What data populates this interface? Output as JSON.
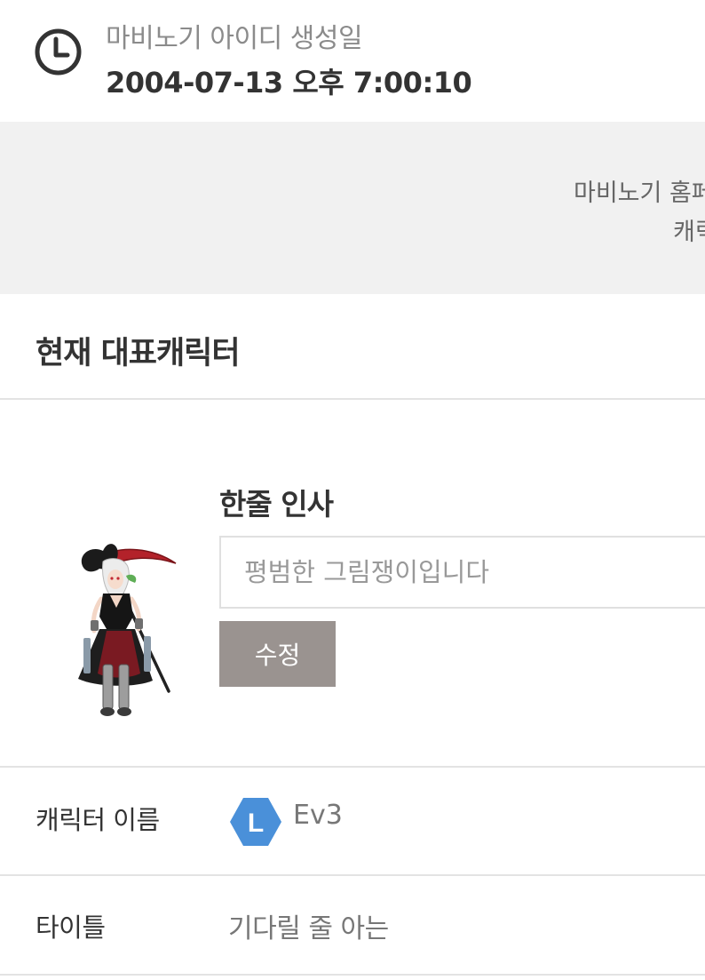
{
  "created": {
    "icon": "clock-icon",
    "label": "마비노기 아이디 생성일",
    "value": "2004-07-13 오후 7:00:10"
  },
  "notice": {
    "line1": "마비노기 홈페",
    "line2": "캐릭"
  },
  "section": {
    "title": "현재 대표캐릭터"
  },
  "profile": {
    "greeting_label": "한줄 인사",
    "greeting_value": "평범한 그림쟁이입니다",
    "edit_button": "수정"
  },
  "character": {
    "name_label": "캐릭터 이름",
    "server_badge_letter": "L",
    "server_badge_color": "#4a90d9",
    "name": "Ev3",
    "title_label": "타이틀",
    "title": "기다릴 줄 아는"
  },
  "colors": {
    "notice_background": "#f1f1f1",
    "button_background": "#9a9390",
    "divider": "#e3e3e3"
  }
}
